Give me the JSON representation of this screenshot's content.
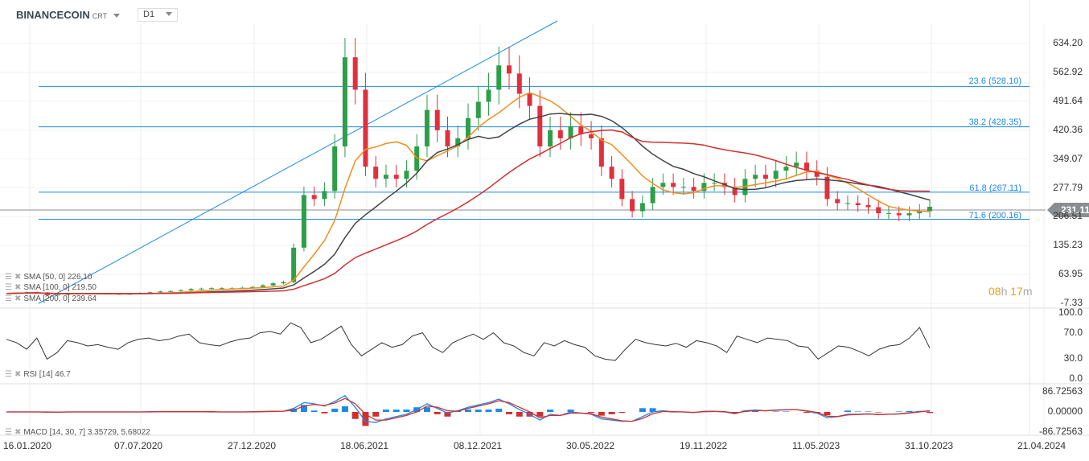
{
  "header": {
    "symbol": "BINANCECOIN",
    "symbol_type": "CRT",
    "timeframe": "D1"
  },
  "legend": {
    "sma50": "SMA [50, 0] 226.10",
    "sma100": "SMA [100, 0] 219.50",
    "sma200": "SMA [200, 0] 239.64",
    "rsi": "RSI [14] 46.7",
    "macd": "MACD [14, 30, 7] 3.35729, 5.68022"
  },
  "last_price": "231.11",
  "timer": {
    "hours": "08",
    "h": "h",
    "minutes": "17",
    "m": "m"
  },
  "colors": {
    "up": "#2e9e48",
    "down": "#e0303c",
    "sma50": "#f28e1c",
    "sma100": "#444444",
    "sma200": "#d32f2f",
    "fib": "#1e88e5"
  },
  "chart_data": {
    "type": "line",
    "title": "BINANCECOIN D1",
    "price_axis": [
      "634.20",
      "562.92",
      "491.64",
      "420.36",
      "349.07",
      "277.79",
      "206.51",
      "135.23",
      "63.95",
      "-7.33"
    ],
    "ylim": [
      -7.33,
      634.2
    ],
    "x_labels": [
      "16.01.2020",
      "07.07.2020",
      "27.12.2020",
      "18.06.2021",
      "08.12.2021",
      "30.05.2022",
      "19.11.2022",
      "11.05.2023",
      "31.10.2023",
      "21.04.2024"
    ],
    "fib_levels": [
      {
        "label": "23.6 (528.10)",
        "value": 528.1
      },
      {
        "label": "38.2 (428.35)",
        "value": 428.35
      },
      {
        "label": "61.8 (267.11)",
        "value": 267.11
      },
      {
        "label": "71.6 (200.16)",
        "value": 200.16
      }
    ],
    "price_weekly_close": [
      17,
      18,
      20,
      19,
      13,
      14,
      16,
      17,
      17,
      17,
      16,
      15,
      16,
      18,
      20,
      22,
      23,
      25,
      28,
      29,
      30,
      30,
      30,
      31,
      33,
      37,
      42,
      45,
      130,
      260,
      250,
      270,
      380,
      600,
      520,
      330,
      300,
      310,
      300,
      320,
      380,
      470,
      420,
      380,
      400,
      450,
      490,
      520,
      580,
      560,
      510,
      480,
      380,
      420,
      400,
      430,
      410,
      400,
      330,
      300,
      250,
      220,
      240,
      280,
      290,
      280,
      280,
      270,
      290,
      290,
      280,
      260,
      300,
      310,
      300,
      320,
      330,
      340,
      320,
      305,
      250,
      240,
      240,
      235,
      230,
      215,
      215,
      210,
      215,
      220,
      231
    ],
    "rsi": {
      "ylim": [
        0,
        100
      ],
      "ticks": [
        "100.0",
        "70.0",
        "30.0",
        "0.0"
      ],
      "values": [
        60,
        55,
        45,
        62,
        30,
        40,
        58,
        55,
        50,
        52,
        48,
        45,
        55,
        60,
        62,
        58,
        60,
        65,
        68,
        55,
        52,
        50,
        56,
        60,
        62,
        70,
        72,
        68,
        85,
        78,
        55,
        60,
        70,
        80,
        52,
        35,
        45,
        55,
        48,
        52,
        65,
        70,
        48,
        40,
        55,
        62,
        68,
        60,
        70,
        55,
        50,
        40,
        35,
        55,
        50,
        58,
        52,
        48,
        35,
        30,
        28,
        45,
        60,
        55,
        52,
        50,
        54,
        48,
        58,
        55,
        50,
        40,
        65,
        60,
        55,
        62,
        60,
        58,
        50,
        48,
        30,
        40,
        50,
        48,
        42,
        35,
        45,
        50,
        52,
        62,
        78,
        46.7
      ]
    },
    "macd": {
      "ticks": [
        "86.72563",
        "0.00000",
        "-86.72563"
      ],
      "macd": [
        0,
        0,
        0,
        0,
        -1,
        -1,
        0,
        0,
        0,
        0,
        0,
        0,
        0,
        0,
        1,
        1,
        1,
        1,
        1,
        1,
        0,
        0,
        0,
        0,
        1,
        2,
        3,
        3,
        15,
        40,
        35,
        25,
        45,
        70,
        20,
        -40,
        -45,
        -30,
        -20,
        -10,
        10,
        35,
        15,
        -5,
        5,
        20,
        30,
        40,
        55,
        35,
        10,
        -10,
        -35,
        -10,
        -15,
        0,
        -5,
        -10,
        -30,
        -35,
        -40,
        -40,
        -20,
        0,
        5,
        0,
        0,
        -3,
        3,
        3,
        0,
        -8,
        5,
        8,
        5,
        8,
        10,
        10,
        3,
        -5,
        -25,
        -20,
        -10,
        -10,
        -8,
        -12,
        -10,
        -8,
        -3,
        2,
        3.36
      ],
      "signal": [
        0,
        0,
        0,
        0,
        0,
        -1,
        0,
        0,
        0,
        0,
        0,
        0,
        0,
        0,
        0,
        1,
        1,
        1,
        1,
        1,
        1,
        0,
        0,
        0,
        0,
        1,
        2,
        3,
        8,
        25,
        32,
        28,
        38,
        58,
        35,
        -10,
        -35,
        -35,
        -25,
        -15,
        0,
        25,
        20,
        5,
        3,
        15,
        25,
        35,
        48,
        40,
        20,
        0,
        -25,
        -15,
        -15,
        -5,
        -5,
        -8,
        -22,
        -30,
        -38,
        -40,
        -28,
        -8,
        2,
        1,
        0,
        -2,
        1,
        2,
        1,
        -5,
        2,
        6,
        5,
        7,
        9,
        10,
        5,
        -2,
        -18,
        -20,
        -13,
        -11,
        -9,
        -11,
        -10,
        -9,
        -5,
        0,
        5.68
      ]
    }
  }
}
